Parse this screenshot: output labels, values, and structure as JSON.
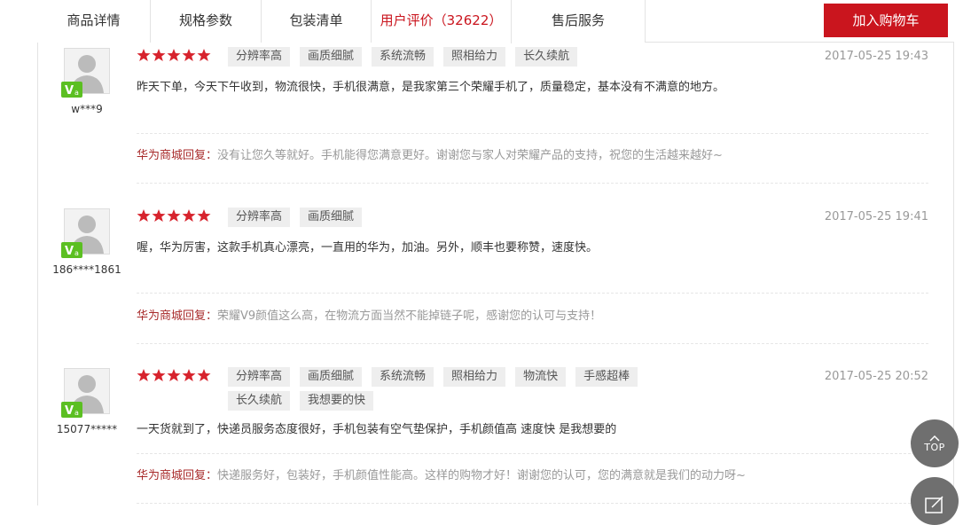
{
  "tabs": [
    {
      "label": "商品详情",
      "active": false
    },
    {
      "label": "规格参数",
      "active": false
    },
    {
      "label": "包装清单",
      "active": false
    },
    {
      "label": "用户评价（32622）",
      "active": true
    },
    {
      "label": "售后服务",
      "active": false
    }
  ],
  "cart_button": {
    "label": "加入购物车"
  },
  "reply_label": "华为商城回复：",
  "reviews": [
    {
      "username": "w***9",
      "stars": 5,
      "tags": [
        "分辨率高",
        "画质细腻",
        "系统流畅",
        "照相给力",
        "长久续航"
      ],
      "date": "2017-05-25 19:43",
      "content": "昨天下单，今天下午收到，物流很快，手机很满意，是我家第三个荣耀手机了，质量稳定，基本没有不满意的地方。",
      "reply": "没有让您久等就好。手机能得您满意更好。谢谢您与家人对荣耀产品的支持，祝您的生活越来越好~"
    },
    {
      "username": "186****1861",
      "stars": 5,
      "tags": [
        "分辨率高",
        "画质细腻"
      ],
      "date": "2017-05-25 19:41",
      "content": "喔，华为厉害，这款手机真心漂亮，一直用的华为，加油。另外，顺丰也要称赞，速度快。",
      "reply": "荣耀V9颜值这么高，在物流方面当然不能掉链子呢，感谢您的认可与支持！"
    },
    {
      "username": "15077*****",
      "stars": 5,
      "tags": [
        "分辨率高",
        "画质细腻",
        "系统流畅",
        "照相给力",
        "物流快",
        "手感超棒",
        "长久续航",
        "我想要的快"
      ],
      "date": "2017-05-25 20:52",
      "content": "一天货就到了，快递员服务态度很好，手机包装有空气垫保护，手机颜值高 速度快 是我想要的",
      "reply": "快递服务好，包装好，手机颜值性能高。这样的购物才好！谢谢您的认可，您的满意就是我们的动力呀~"
    }
  ],
  "floating": {
    "top_label": "TOP"
  },
  "colors": {
    "accent": "#ca151e",
    "star": "#d7232d",
    "vip_badge": "#5bbf22"
  }
}
